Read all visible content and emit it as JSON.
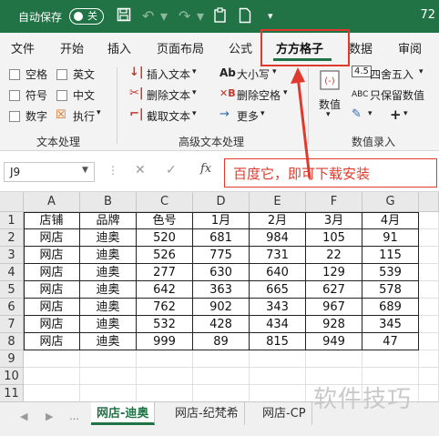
{
  "titlebar": {
    "autosave_label": "自动保存",
    "toggle_label": "关",
    "right_number": "72"
  },
  "tabs": [
    {
      "label": "文件"
    },
    {
      "label": "开始"
    },
    {
      "label": "插入"
    },
    {
      "label": "页面布局"
    },
    {
      "label": "公式"
    },
    {
      "label": "方方格子"
    },
    {
      "label": "数据"
    },
    {
      "label": "审阅"
    }
  ],
  "ribbon": {
    "text_group": {
      "label": "文本处理",
      "items": [
        "空格",
        "英文",
        "符号",
        "中文",
        "数字",
        "执行"
      ]
    },
    "adv_group": {
      "label": "高级文本处理",
      "insert_text": "插入文本",
      "delete_text": "删除文本",
      "extract_text": "截取文本",
      "case": "大小写",
      "delete_space": "删除空格",
      "more": "更多"
    },
    "num_group": {
      "label": "数值录入",
      "numeric": "数值",
      "round": "四舍五入",
      "keep_numeric": "只保留数值",
      "round_icon_text": "4.5",
      "keep_icon_text": "ABC"
    }
  },
  "formula_bar": {
    "name_box": "J9",
    "fx": "fx",
    "annotation": "百度它，即可下载安装"
  },
  "grid": {
    "columns": [
      "A",
      "B",
      "C",
      "D",
      "E",
      "F",
      "G"
    ],
    "rows": [
      [
        "店铺",
        "品牌",
        "色号",
        "1月",
        "2月",
        "3月",
        "4月"
      ],
      [
        "网店",
        "迪奥",
        "520",
        "681",
        "984",
        "105",
        "91"
      ],
      [
        "网店",
        "迪奥",
        "526",
        "775",
        "731",
        "22",
        "115"
      ],
      [
        "网店",
        "迪奥",
        "277",
        "630",
        "640",
        "129",
        "539"
      ],
      [
        "网店",
        "迪奥",
        "642",
        "363",
        "665",
        "627",
        "578"
      ],
      [
        "网店",
        "迪奥",
        "762",
        "902",
        "343",
        "967",
        "689"
      ],
      [
        "网店",
        "迪奥",
        "532",
        "428",
        "434",
        "928",
        "345"
      ],
      [
        "网店",
        "迪奥",
        "999",
        "89",
        "815",
        "949",
        "47"
      ]
    ],
    "row_numbers": [
      "1",
      "2",
      "3",
      "4",
      "5",
      "6",
      "7",
      "8",
      "9",
      "10",
      "11"
    ]
  },
  "sheets": [
    {
      "label": "网店-迪奥"
    },
    {
      "label": "网店-纪梵希"
    },
    {
      "label": "网店-CP"
    }
  ],
  "watermark": "软件技巧",
  "colors": {
    "excel_green": "#217346",
    "annotation_red": "#e03a2f"
  }
}
